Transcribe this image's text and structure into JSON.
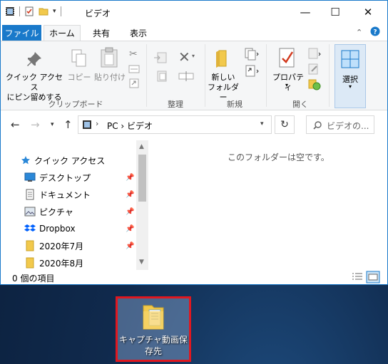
{
  "window": {
    "title": "ビデオ",
    "controls": {
      "minimize": "—",
      "maximize": "☐",
      "close": "✕"
    }
  },
  "tabs": [
    {
      "label": "ファイル"
    },
    {
      "label": "ホーム"
    },
    {
      "label": "共有"
    },
    {
      "label": "表示"
    }
  ],
  "ribbon": {
    "quick_access_pin": {
      "line1": "クイック アクセス",
      "line2": "にピン留めする"
    },
    "copy": "コピー",
    "paste": "貼り付け",
    "group_clipboard": "クリップボード",
    "group_organize": "整理",
    "new_folder": {
      "line1": "新しい",
      "line2": "フォルダー"
    },
    "group_new": "新規",
    "properties": "プロパティ",
    "group_open": "開く",
    "select": "選択"
  },
  "address": {
    "path": "PC  ›  ビデオ",
    "search_placeholder": "ビデオの..."
  },
  "nav_pane": {
    "quick_access": "クイック アクセス",
    "items": [
      {
        "label": "デスクトップ",
        "icon": "desktop-icon"
      },
      {
        "label": "ドキュメント",
        "icon": "document-icon"
      },
      {
        "label": "ピクチャ",
        "icon": "picture-icon"
      },
      {
        "label": "Dropbox",
        "icon": "dropbox-icon"
      },
      {
        "label": "2020年7月",
        "icon": "folder-icon"
      },
      {
        "label": "2020年8月",
        "icon": "folder-icon"
      }
    ]
  },
  "content": {
    "empty_message": "このフォルダーは空です。"
  },
  "status": {
    "item_count": "0 個の項目"
  },
  "desktop_icon": {
    "label": "キャプチャ動画保存先"
  },
  "colors": {
    "accent": "#1979ca",
    "highlight_border": "#e0171f"
  }
}
